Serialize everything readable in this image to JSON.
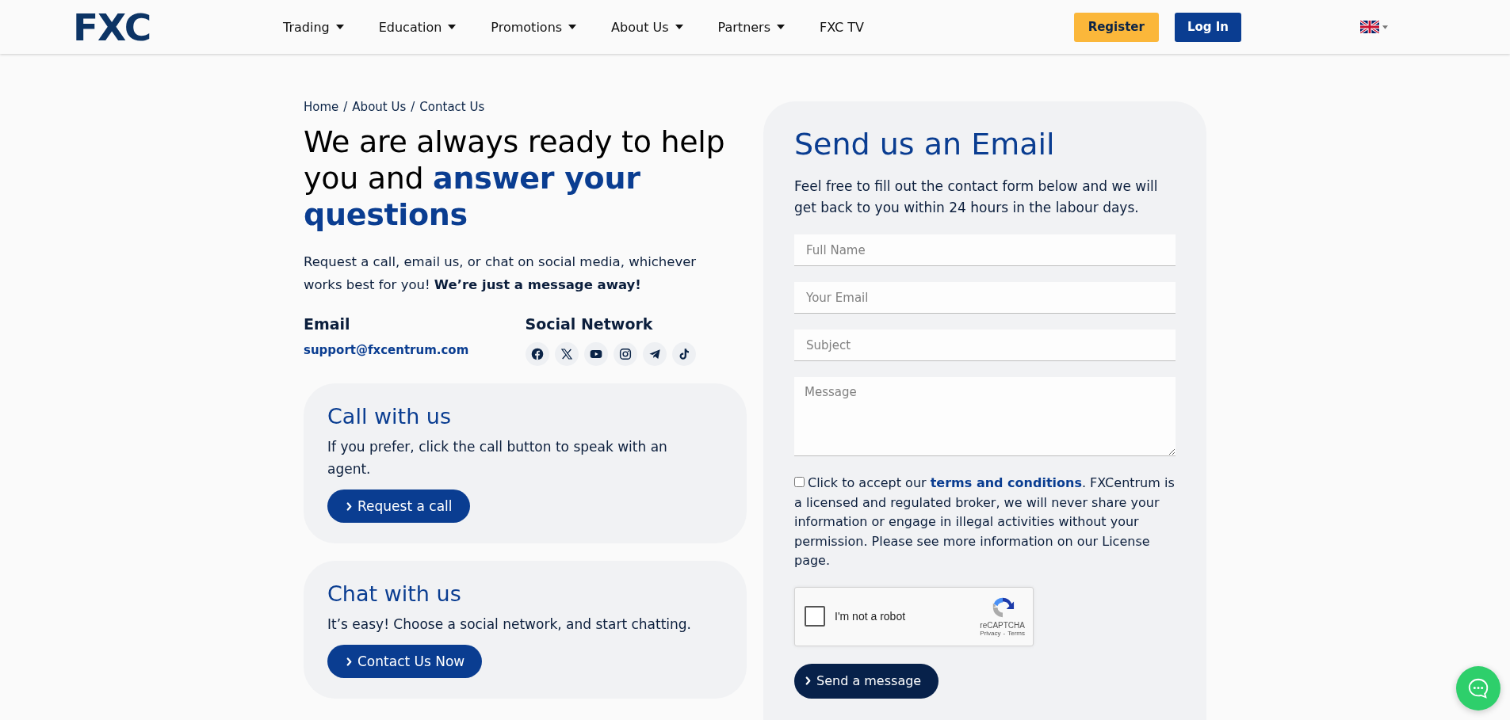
{
  "header": {
    "logo": "FXC",
    "nav": [
      {
        "label": "Trading",
        "has_menu": true
      },
      {
        "label": "Education",
        "has_menu": true
      },
      {
        "label": "Promotions",
        "has_menu": true
      },
      {
        "label": "About Us",
        "has_menu": true
      },
      {
        "label": "Partners",
        "has_menu": true
      },
      {
        "label": "FXC TV",
        "has_menu": false
      }
    ],
    "register": "Register",
    "login": "Log In"
  },
  "breadcrumb": {
    "items": [
      "Home",
      "About Us",
      "Contact Us"
    ],
    "separator": "/"
  },
  "headline": "We are always ready to help you and **answer your questions**",
  "intro": "Request a call, email us, or chat on social media, whichever works best for you! **We’re just a message away!**",
  "email": {
    "label": "Email",
    "address": "support@fxcentrum.com"
  },
  "social": {
    "label": "Social Network",
    "networks": [
      {
        "kind": "facebook"
      },
      {
        "kind": "x"
      },
      {
        "kind": "youtube"
      },
      {
        "kind": "instagram"
      },
      {
        "kind": "telegram"
      },
      {
        "kind": "tiktok"
      }
    ]
  },
  "cards": [
    {
      "title": "Call with us",
      "text": "If you prefer, click the call button to speak with an agent.",
      "button": "Request a call"
    },
    {
      "title": "Chat with us",
      "text": "It’s easy! Choose a social network, and start chatting.",
      "button": "Contact Us Now"
    }
  ],
  "form": {
    "title": "Send us an Email",
    "text": "Feel free to fill out the contact form below and we will get back to you within 24 hours in the labour days.",
    "fields": [
      {
        "kind": "input",
        "placeholder": "Full Name"
      },
      {
        "kind": "input",
        "placeholder": "Your Email"
      },
      {
        "kind": "input",
        "placeholder": "Subject"
      },
      {
        "kind": "textarea",
        "placeholder": "Message"
      }
    ],
    "consent": {
      "checked": false,
      "before": "Click to accept our ",
      "link": "terms and conditions",
      "after": ". FXCentrum is a licensed and regulated broker, we will never share your information or engage in illegal activities without your permission. Please see more information on our License page."
    },
    "recaptcha": {
      "checked": false,
      "label": "I'm not a robot",
      "brand": "reCAPTCHA",
      "privacy": "Privacy",
      "separator": "-",
      "terms": "Terms"
    },
    "submit": "Send a message"
  }
}
